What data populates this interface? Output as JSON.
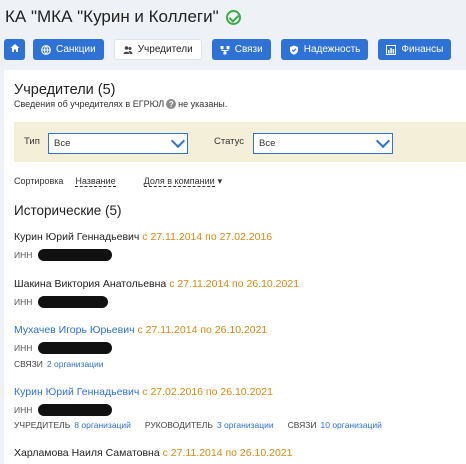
{
  "company": {
    "title": "КА \"МКА \"Курин и Коллеги\""
  },
  "tabs": [
    {
      "label": "",
      "icon": "home-icon"
    },
    {
      "label": "Санкции",
      "icon": "globe-icon"
    },
    {
      "label": "Учредители",
      "icon": "people-icon"
    },
    {
      "label": "Связи",
      "icon": "network-icon"
    },
    {
      "label": "Надежность",
      "icon": "shield-icon"
    },
    {
      "label": "Финансы",
      "icon": "bar-chart-icon"
    }
  ],
  "founders": {
    "heading": "Учредители (5)",
    "note_before": "Сведения об учредителях в ЕГРЮЛ",
    "note_after": "не указаны."
  },
  "filters": {
    "type_label": "Тип",
    "type_value": "Все",
    "status_label": "Статус",
    "status_value": "Все"
  },
  "sort": {
    "label": "Сортировка",
    "by_name": "Название",
    "by_share": "Доля в компании",
    "arrow": "▾"
  },
  "historical": {
    "heading": "Исторические (5)",
    "inn_label": "ИНН",
    "people": [
      {
        "name": "Курин Юрий Геннадьевич",
        "dates": "с 27.11.2014 по 27.02.2016"
      },
      {
        "name": "Шакина Виктория Анатольевна",
        "dates": "с 27.11.2014 по 26.10.2021"
      },
      {
        "name": "Мухачев Игорь Юрьевич",
        "dates": "с 27.11.2014 по 26.10.2021",
        "links_label": "СВЯЗИ",
        "links_value": "2 организации"
      },
      {
        "name": "Курин Юрий Геннадьевич",
        "dates": "с 27.02.2016 по 26.10.2021",
        "founder_label": "УЧРЕДИТЕЛЬ",
        "founder_value": "8 организаций",
        "head_label": "РУКОВОДИТЕЛЬ",
        "head_value": "3 организации",
        "links_label": "СВЯЗИ",
        "links_value": "10 организаций"
      },
      {
        "name": "Харламова Наиля Саматовна",
        "dates": "с 27.11.2014 по 26.10.2021"
      }
    ]
  },
  "colors": {
    "accent": "#2f72d6",
    "date": "#d68a10",
    "filter_bg": "#f3efd9",
    "verified": "#3ea84a"
  }
}
